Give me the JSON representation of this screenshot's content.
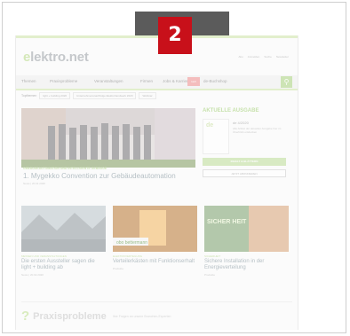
{
  "badge": {
    "number": "2"
  },
  "site": {
    "logo_prefix": "e",
    "logo_rest": "lektro.net",
    "top_links": [
      "Abo",
      "Anmelden",
      "Suche",
      "Newsletter"
    ]
  },
  "nav": {
    "items": [
      "Themen",
      "Praxisprobleme",
      "Veranstaltungen",
      "Firmen",
      "Jobs & Karriere"
    ],
    "highlight_label": "Heft",
    "extra_label": "de-Buchshop",
    "search_icon": "search-icon"
  },
  "topics": {
    "label": "Topthemen",
    "chips": [
      "light + building 2020",
      "Unternehmensnachfolge Elektrohandwerk 2020",
      "Webinar"
    ]
  },
  "hero": {
    "kicker": "GEBÄUDEAUTOMATION UND INTELLIGENTE GEBÄUDE",
    "title": "1. Mygekko Convention zur Gebäudeautomation",
    "date": "News | 20.01.2020"
  },
  "issue": {
    "heading": "AKTUELLE AUSGABE",
    "cover_label": "de",
    "issue_name": "de 4/2020",
    "issue_desc": "Alle Artikel der aktuellen Ausgabe hier im Überblick entdecken",
    "primary_button": "INHALT & BLÄTTERN",
    "secondary_button": "JETZT ABONNIEREN"
  },
  "cards": [
    {
      "kicker": "MESSEN UND VERANSTALTUNGEN",
      "title": "Die ersten Aussteller sagen die light + building ab",
      "date": "News | 20.02.2020"
    },
    {
      "kicker": "ELEKTROVERTEILUNG",
      "title": "Verteilerkästen mit Funktionserhalt",
      "date": "Produkte"
    },
    {
      "kicker": "SICHERHEIT",
      "title": "Sichere Installation in der Energieverteilung",
      "date": "Produkte"
    }
  ],
  "card_brands": [
    "obo bettermann",
    "SICHER HEIT"
  ],
  "praxis": {
    "mark": "?",
    "title": "Praxisprobleme",
    "subtitle": "Ihre Fragen an unsere Branchen-Experten"
  },
  "colors": {
    "brand_green": "#9ccc6a",
    "badge_red": "#c8101a",
    "overlay_gray": "#5b5b5b"
  }
}
